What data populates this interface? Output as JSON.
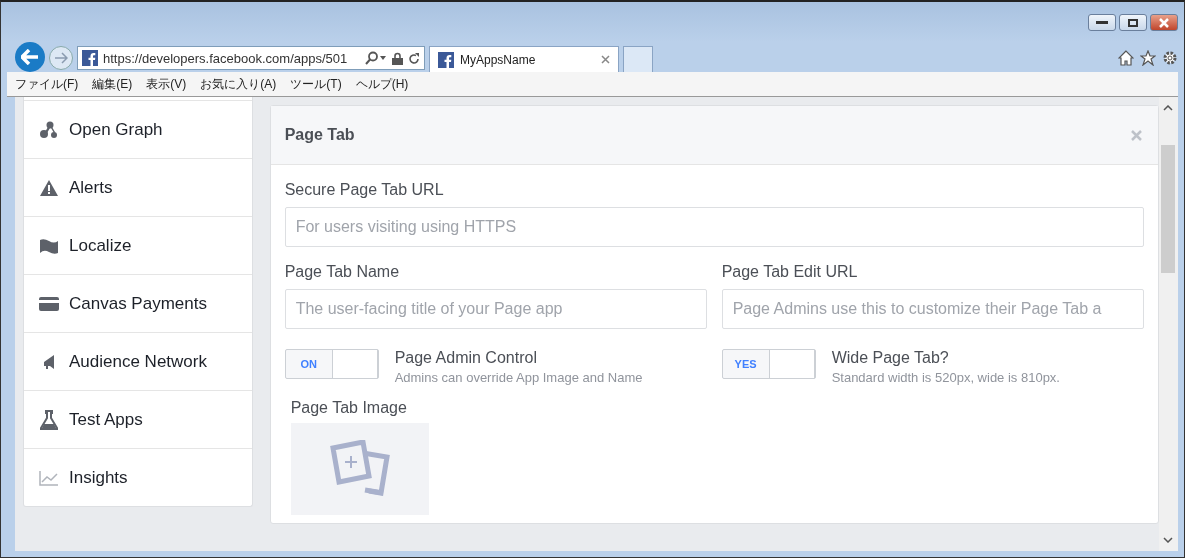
{
  "browser": {
    "url": "https://developers.facebook.com/apps/501",
    "tabs": [
      {
        "label": "MyAppsName",
        "selected": true
      }
    ],
    "menu": [
      "ファイル(F)",
      "編集(E)",
      "表示(V)",
      "お気に入り(A)",
      "ツール(T)",
      "ヘルプ(H)"
    ]
  },
  "sidebar": {
    "items": [
      {
        "label": "Open Graph"
      },
      {
        "label": "Alerts"
      },
      {
        "label": "Localize"
      },
      {
        "label": "Canvas Payments"
      },
      {
        "label": "Audience Network"
      },
      {
        "label": "Test Apps"
      },
      {
        "label": "Insights"
      }
    ]
  },
  "panel": {
    "title": "Page Tab",
    "secure_url": {
      "label": "Secure Page Tab URL",
      "placeholder": "For users visiting using HTTPS"
    },
    "fields": [
      {
        "label": "Page Tab Name",
        "placeholder": "The user-facing title of your Page app"
      },
      {
        "label": "Page Tab Edit URL",
        "placeholder": "Page Admins use this to customize their Page Tab a"
      }
    ],
    "toggles": [
      {
        "state": "ON",
        "on": true,
        "title": "Page Admin Control",
        "description": "Admins can override App Image and Name"
      },
      {
        "state": "YES",
        "on": true,
        "title": "Wide Page Tab?",
        "description": "Standard width is 520px, wide is 810px."
      }
    ],
    "image": {
      "label": "Page Tab Image"
    }
  }
}
